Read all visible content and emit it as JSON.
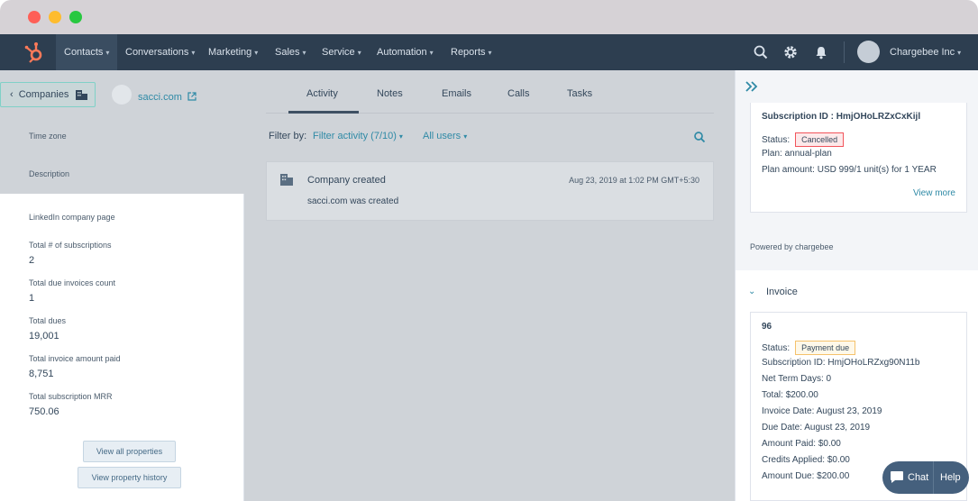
{
  "nav": {
    "items": [
      "Contacts",
      "Conversations",
      "Marketing",
      "Sales",
      "Service",
      "Automation",
      "Reports"
    ],
    "account": "Chargebee Inc"
  },
  "left": {
    "back_label": "Companies",
    "company_link": "sacci.com",
    "overlay_fields": [
      "Time zone",
      "Description"
    ],
    "linkedin_label": "LinkedIn company page",
    "properties": [
      {
        "label": "Total # of subscriptions",
        "value": "2"
      },
      {
        "label": "Total due invoices count",
        "value": "1"
      },
      {
        "label": "Total dues",
        "value": "19,001"
      },
      {
        "label": "Total invoice amount paid",
        "value": "8,751"
      },
      {
        "label": "Total subscription MRR",
        "value": "750.06"
      }
    ],
    "view_all": "View all properties",
    "view_history": "View property history"
  },
  "middle": {
    "tabs": [
      "Activity",
      "Notes",
      "Emails",
      "Calls",
      "Tasks"
    ],
    "filter_label": "Filter by:",
    "filter_activity": "Filter activity (7/10)",
    "filter_users": "All users",
    "card": {
      "title": "Company created",
      "date": "Aug 23, 2019 at 1:02 PM GMT+5:30",
      "body": "sacci.com was created"
    }
  },
  "right": {
    "subscription": {
      "id_line": "Subscription ID : HmjOHoLRZxCxKijl",
      "status_label": "Status:",
      "status": "Cancelled",
      "plan_label": "Plan:",
      "plan": "annual-plan",
      "amount_label": "Plan amount:",
      "amount": "USD 999/1 unit(s) for 1 YEAR",
      "view_more": "View more"
    },
    "powered": "Powered by chargebee",
    "invoice_header": "Invoice",
    "invoice": {
      "number": "96",
      "status_label": "Status:",
      "status": "Payment due",
      "sub_id_label": "Subscription ID:",
      "sub_id": "HmjOHoLRZxg90N11b",
      "net_term_label": "Net Term Days:",
      "net_term": "0",
      "total_label": "Total:",
      "total": "$200.00",
      "invoice_date_label": "Invoice Date:",
      "invoice_date": "August 23, 2019",
      "due_date_label": "Due Date:",
      "due_date": "August 23, 2019",
      "amount_paid_label": "Amount Paid:",
      "amount_paid": "$0.00",
      "credits_label": "Credits Applied:",
      "credits": "$0.00",
      "amount_due_label": "Amount Due:",
      "amount_due": "$200.00"
    }
  },
  "chat": {
    "chat": "Chat",
    "help": "Help"
  }
}
